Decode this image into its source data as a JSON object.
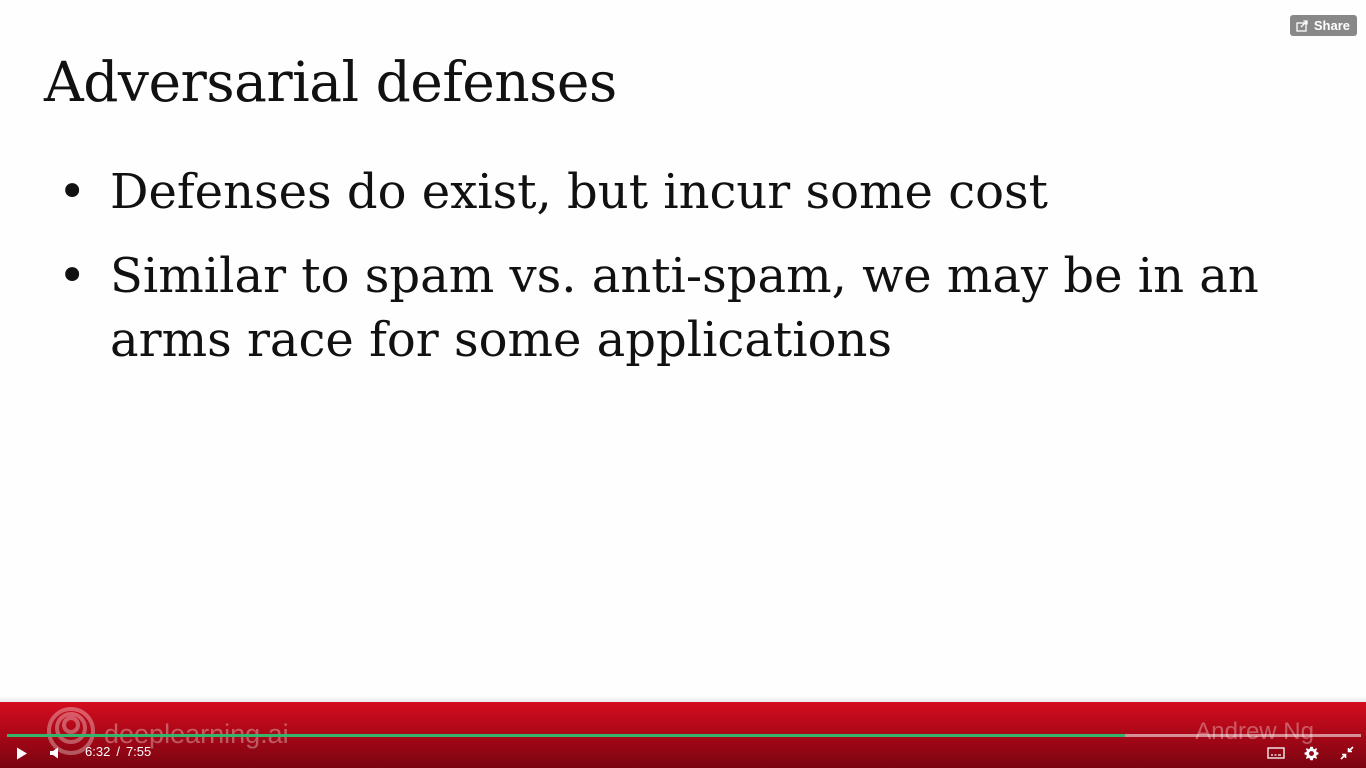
{
  "share": {
    "label": "Share"
  },
  "slide": {
    "title": "Adversarial defenses",
    "bullets": [
      "Defenses do exist, but incur some cost",
      "Similar to spam vs. anti-spam, we may be in an arms race for some applications"
    ],
    "bullet_symbol": "•"
  },
  "branding": {
    "logo_text": "deeplearning.ai",
    "presenter": "Andrew Ng"
  },
  "player": {
    "current_time": "6:32",
    "separator": "/",
    "duration": "7:55",
    "progress_fraction": 0.826,
    "accent_color": "#35b46b",
    "controls": [
      "play-icon",
      "volume-icon",
      "captions-icon",
      "settings-icon",
      "exit-fullscreen-icon"
    ]
  },
  "colors": {
    "brand_red": "#c70a1c",
    "text": "#111111"
  }
}
